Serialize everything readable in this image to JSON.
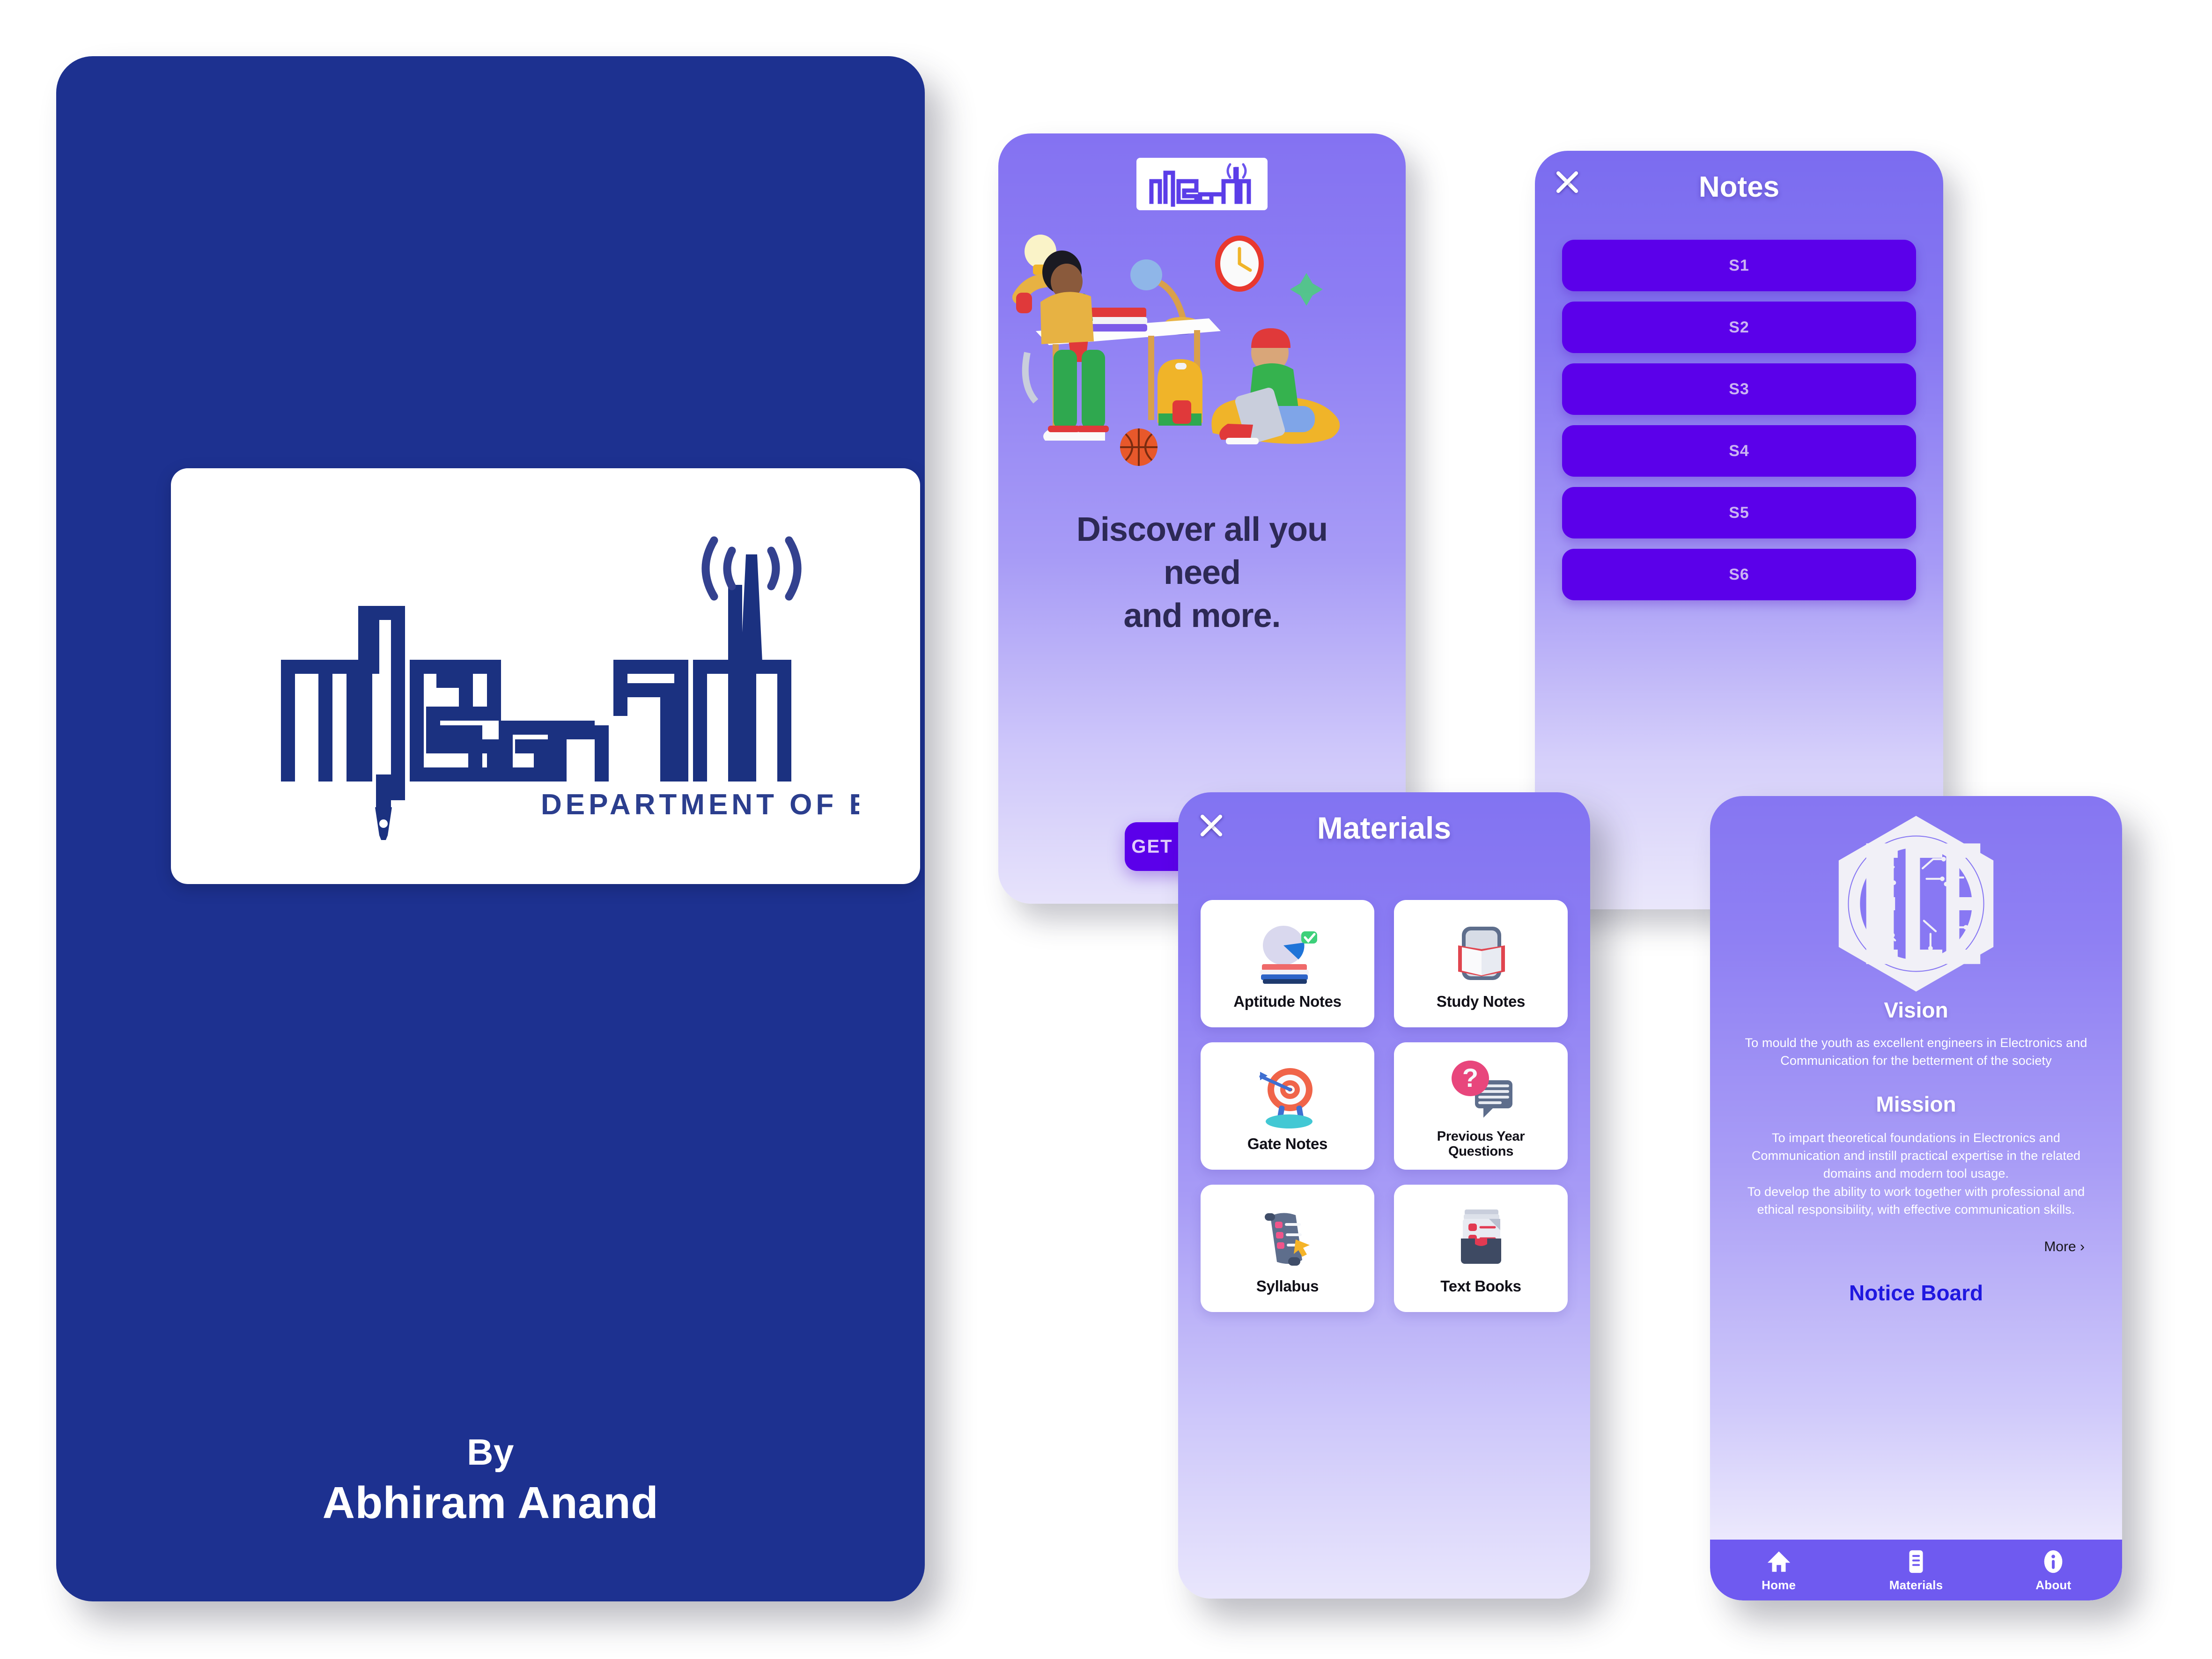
{
  "splash": {
    "logo": {
      "wordmark_script": "വിജ്ഞാനം",
      "subtitle": "DEPARTMENT OF ECE",
      "icons": [
        "pen-nib-icon",
        "radio-tower-icon"
      ]
    },
    "credit_prefix": "By",
    "author": "Abhiram Anand",
    "background_color": "#1D3190"
  },
  "onboarding": {
    "logo_alt": "വിജ്ഞാനം",
    "headline": "Discover all you\nneed\nand more.",
    "headline_lines": [
      "Discover all you",
      "need",
      "and more."
    ],
    "cta_label": "GET STARTED",
    "illustration": "students-studying-illustration",
    "illustration_items": [
      "lightbulb",
      "wall-clock",
      "desk-lamp",
      "book-stack",
      "plant-pot",
      "backpack",
      "basketball",
      "beanbag",
      "laptop"
    ]
  },
  "notes_screen": {
    "title": "Notes",
    "close_icon": "close-icon",
    "semesters": [
      "S1",
      "S2",
      "S3",
      "S4",
      "S5",
      "S6"
    ],
    "button_color": "#5B00EA"
  },
  "materials_screen": {
    "title": "Materials",
    "close_icon": "close-icon",
    "cards": [
      {
        "label": "Aptitude Notes",
        "icon": "pie-chart-books-icon",
        "two_line": false
      },
      {
        "label": "Study Notes",
        "icon": "open-book-tablet-icon",
        "two_line": false
      },
      {
        "label": "Gate Notes",
        "icon": "target-dartboard-icon",
        "two_line": false
      },
      {
        "label": "Previous Year\nQuestions",
        "icon": "question-chat-icon",
        "two_line": true
      },
      {
        "label": "Syllabus",
        "icon": "scroll-checklist-icon",
        "two_line": false
      },
      {
        "label": "Text Books",
        "icon": "book-tray-icon",
        "two_line": false
      }
    ]
  },
  "about_screen": {
    "emblem_alt": "ECE department hexagon emblem",
    "vision_title": "Vision",
    "vision_body": "To mould the youth as excellent engineers in Electronics and Communication for the betterment of the society",
    "mission_title": "Mission",
    "mission_body": "To impart theoretical foundations in Electronics and Communication and instill practical expertise in the related domains and modern tool usage.\nTo develop the ability to work together with professional and ethical responsibility, with effective communication skills.",
    "more_label": "More ›",
    "notice_board_label": "Notice Board",
    "nav": [
      {
        "label": "Home",
        "icon": "home-icon"
      },
      {
        "label": "Materials",
        "icon": "document-icon"
      },
      {
        "label": "About",
        "icon": "info-icon"
      }
    ],
    "accent_color": "#6F5AF0",
    "notice_color": "#2018E0"
  }
}
